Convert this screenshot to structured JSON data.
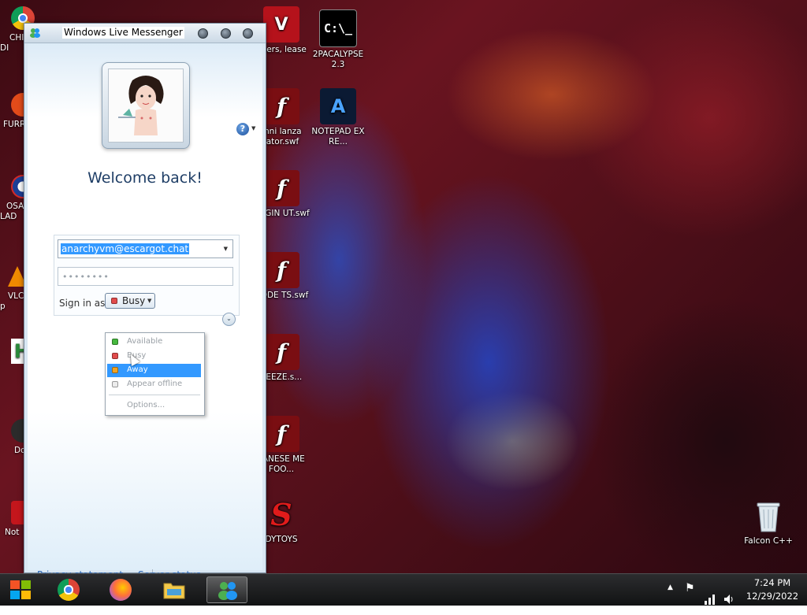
{
  "desktop": {
    "icons": [
      {
        "label": "CHI DI"
      },
      {
        "label": "FURR"
      },
      {
        "label": "OSA LAD"
      },
      {
        "label": "VLC p"
      },
      {
        "label": "Do"
      },
      {
        "label": "Not"
      },
      {
        "label": "2PACALYPSE 2.3"
      },
      {
        "label": "NOTEPAD EX RE..."
      },
      {
        "label": "apers, lease"
      },
      {
        "label": "mni lanza lator.swf"
      },
      {
        "label": "URGIN UT.swf"
      },
      {
        "label": "HODE TS.swf"
      },
      {
        "label": "EEEZE.s..."
      },
      {
        "label": "PANESE ME FOO..."
      },
      {
        "label": "DYTOYS"
      },
      {
        "label": "Falcon C++"
      }
    ]
  },
  "messenger": {
    "title": "Windows Live Messenger",
    "welcome": "Welcome back!",
    "email": "anarchyvm@escargot.chat",
    "password_mask": "••••••••",
    "sign_in_as_label": "Sign in as:",
    "current_status": "Busy",
    "status_menu": [
      {
        "label": "Available",
        "dot": "available"
      },
      {
        "label": "Busy",
        "dot": "busy"
      },
      {
        "label": "Away",
        "dot": "away",
        "selected": true
      },
      {
        "label": "Appear offline",
        "dot": "offline"
      },
      {
        "label": "Options..."
      }
    ],
    "footer": {
      "privacy": "Privacy statement",
      "server_status": "Server status"
    }
  },
  "taskbar": {
    "time": "7:24 PM",
    "date": "12/29/2022"
  },
  "colors": {
    "accent": "#3399ff",
    "link": "#2a64b2",
    "welcome_text": "#1f3e66"
  }
}
